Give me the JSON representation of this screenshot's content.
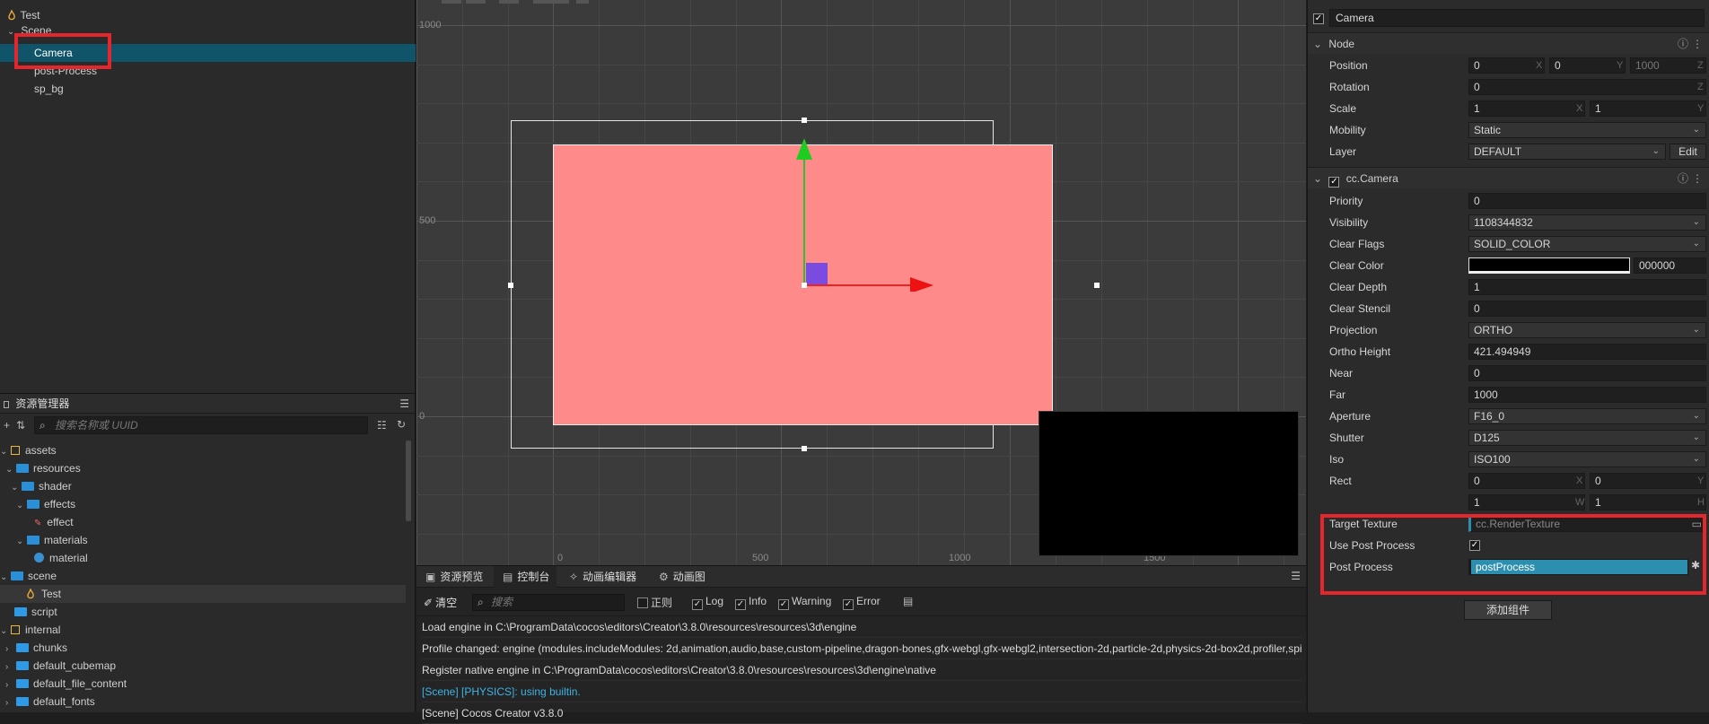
{
  "hierarchy": {
    "items": [
      {
        "label": "Test"
      },
      {
        "label": "Scene"
      },
      {
        "label": "Camera"
      },
      {
        "label": "post-Process"
      },
      {
        "label": "sp_bg"
      }
    ]
  },
  "assets": {
    "title": "资源管理器",
    "search_placeholder": "搜索名称或 UUID",
    "items": [
      {
        "label": "assets"
      },
      {
        "label": "resources"
      },
      {
        "label": "shader"
      },
      {
        "label": "effects"
      },
      {
        "label": "effect"
      },
      {
        "label": "materials"
      },
      {
        "label": "material"
      },
      {
        "label": "scene"
      },
      {
        "label": "Test"
      },
      {
        "label": "script"
      },
      {
        "label": "internal"
      },
      {
        "label": "chunks"
      },
      {
        "label": "default_cubemap"
      },
      {
        "label": "default_file_content"
      },
      {
        "label": "default_fonts"
      }
    ]
  },
  "scene": {
    "ruler_y": [
      "1000",
      "500",
      "0"
    ],
    "ruler_x": [
      "0",
      "500",
      "1000",
      "1500"
    ]
  },
  "console": {
    "tabs": [
      "资源预览",
      "控制台",
      "动画编辑器",
      "动画图"
    ],
    "clear_label": "清空",
    "search_placeholder": "搜索",
    "filters": [
      "正则",
      "Log",
      "Info",
      "Warning",
      "Error"
    ],
    "lines": [
      "Load engine in C:\\ProgramData\\cocos\\editors\\Creator\\3.8.0\\resources\\resources\\3d\\engine",
      "Profile changed: engine (modules.includeModules: 2d,animation,audio,base,custom-pipeline,dragon-bones,gfx-webgl,gfx-webgl2,intersection-2d,particle-2d,physics-2d-box2d,profiler,spi",
      "Register native engine in C:\\ProgramData\\cocos\\editors\\Creator\\3.8.0\\resources\\resources\\3d\\engine\\native",
      "[Scene] [PHYSICS]: using builtin.",
      "[Scene] Cocos Creator v3.8.0"
    ]
  },
  "inspector": {
    "node_name": "Camera",
    "node_section": "Node",
    "position": {
      "label": "Position",
      "x": "0",
      "y": "0",
      "z": "1000"
    },
    "rotation": {
      "label": "Rotation",
      "z": "0"
    },
    "scale": {
      "label": "Scale",
      "x": "1",
      "y": "1"
    },
    "mobility": {
      "label": "Mobility",
      "value": "Static"
    },
    "layer": {
      "label": "Layer",
      "value": "DEFAULT",
      "edit": "Edit"
    },
    "camera_section": "cc.Camera",
    "props": [
      {
        "label": "Priority",
        "value": "0"
      },
      {
        "label": "Visibility",
        "value": "1108344832"
      },
      {
        "label": "Clear Flags",
        "value": "SOLID_COLOR"
      },
      {
        "label": "Clear Color",
        "value": "000000"
      },
      {
        "label": "Clear Depth",
        "value": "1"
      },
      {
        "label": "Clear Stencil",
        "value": "0"
      },
      {
        "label": "Projection",
        "value": "ORTHO"
      },
      {
        "label": "Ortho Height",
        "value": "421.494949"
      },
      {
        "label": "Near",
        "value": "0"
      },
      {
        "label": "Far",
        "value": "1000"
      },
      {
        "label": "Aperture",
        "value": "F16_0"
      },
      {
        "label": "Shutter",
        "value": "D125"
      },
      {
        "label": "Iso",
        "value": "ISO100"
      }
    ],
    "rect": {
      "label": "Rect",
      "x": "0",
      "y": "0",
      "w": "1",
      "h": "1"
    },
    "target_texture": {
      "label": "Target Texture",
      "placeholder": "cc.RenderTexture"
    },
    "use_post_process": {
      "label": "Use Post Process"
    },
    "post_process": {
      "label": "Post Process",
      "value": "postProcess"
    },
    "add_component": "添加组件",
    "axis": {
      "x": "X",
      "y": "Y",
      "z": "Z",
      "w": "W",
      "h": "H"
    }
  },
  "colors": {
    "accent": "#2d8fb0",
    "highlight_red": "#e5272d",
    "sprite": "#ff8a8a"
  }
}
